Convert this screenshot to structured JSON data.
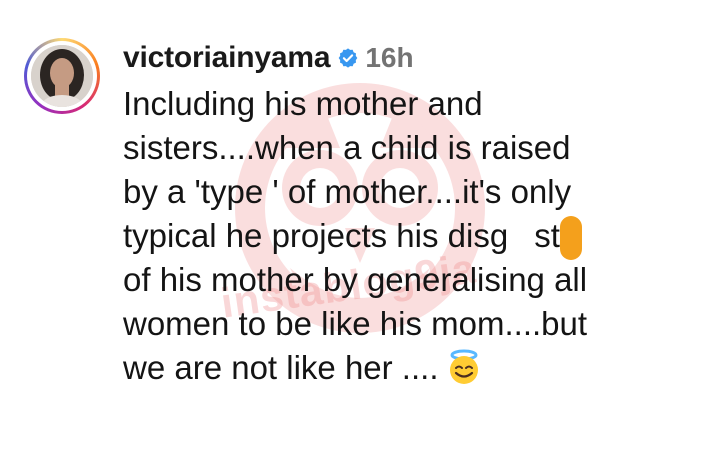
{
  "comment": {
    "username": "victoriainyama",
    "timestamp": "16h",
    "verified": true,
    "verified_color": "#3897f0",
    "lines": [
      "Including his mother and",
      "sisters....when a child is raised",
      "by a 'type ' of mother....it's only",
      "typical he projects his disg",
      "st",
      "of his mother by generalising all",
      "women to be like his mom....but",
      "we are not like her ...."
    ],
    "emoji": "smiling-face-with-halo",
    "watermark": "instablog9ja",
    "watermark_color": "#f08f91"
  }
}
